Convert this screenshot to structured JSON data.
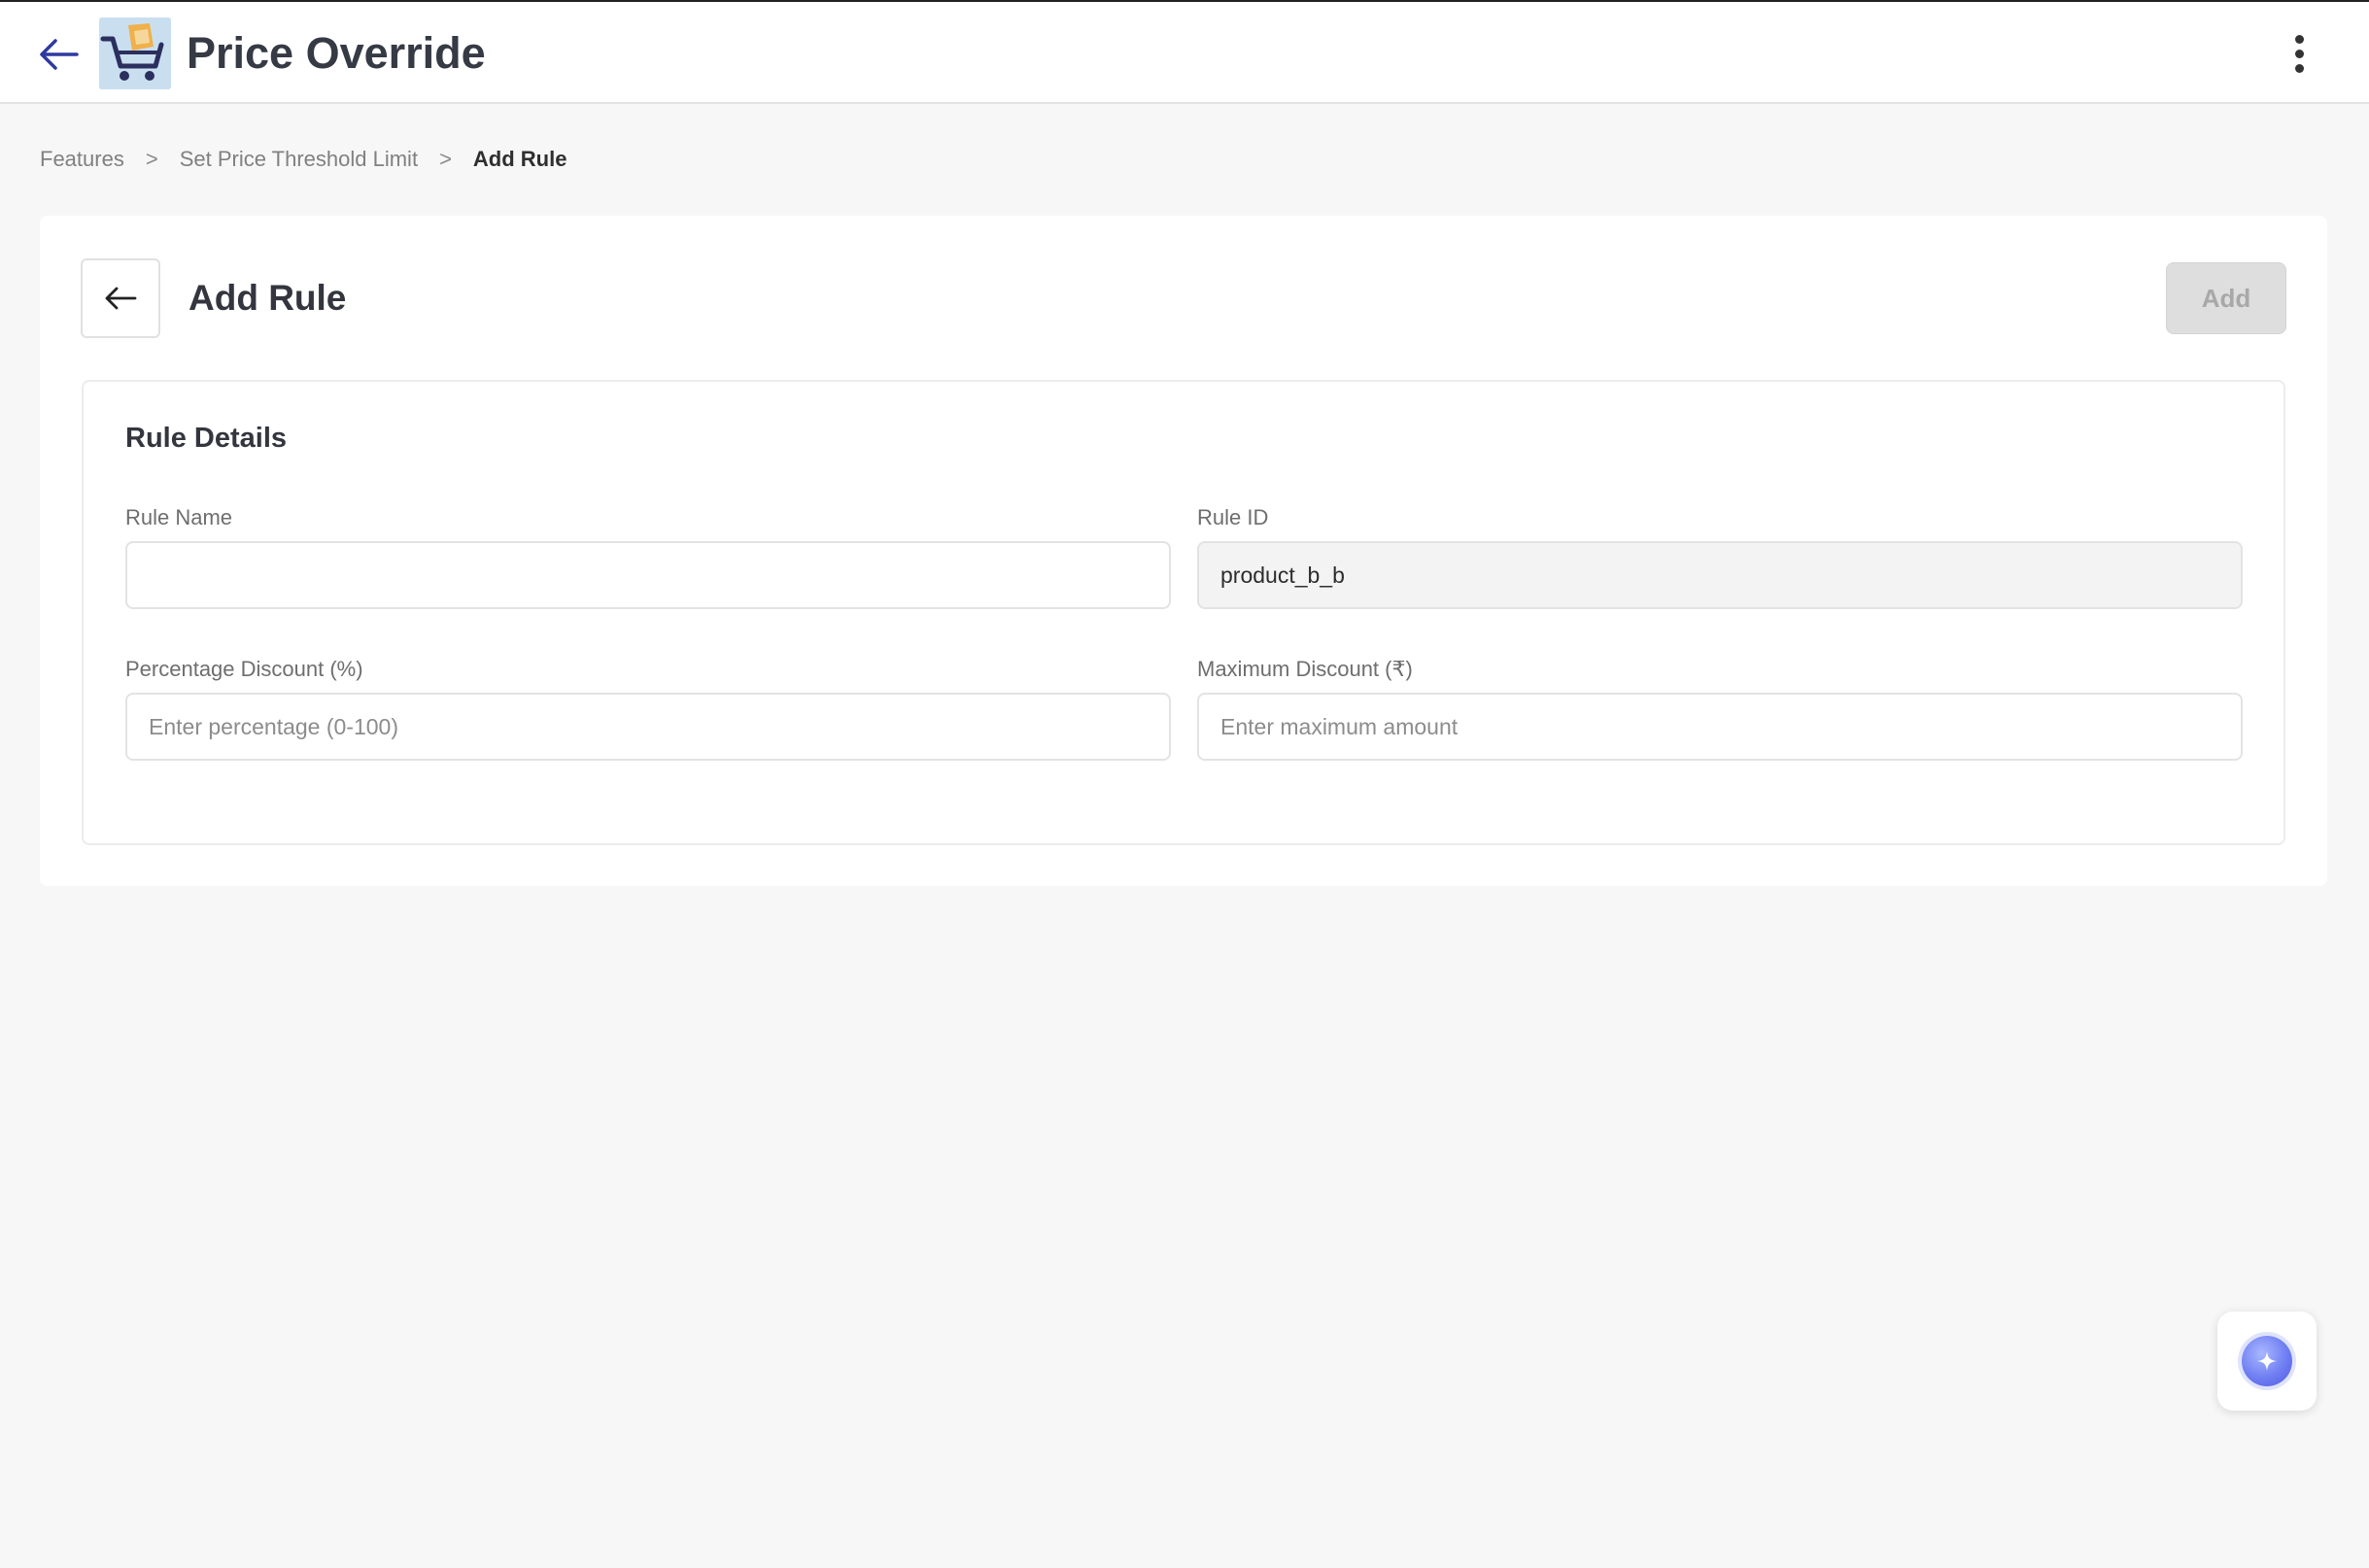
{
  "header": {
    "title": "Price Override",
    "back_icon": "arrow-left-icon",
    "logo_icon": "shopping-cart-logo-icon",
    "menu_icon": "kebab-menu-icon"
  },
  "breadcrumb": {
    "items": [
      "Features",
      "Set Price Threshold Limit",
      "Add Rule"
    ],
    "separator": ">"
  },
  "page": {
    "title": "Add Rule",
    "back_icon": "arrow-left-icon",
    "add_label": "Add",
    "add_disabled": true
  },
  "rule_details": {
    "title": "Rule Details",
    "rule_name": {
      "label": "Rule Name",
      "value": "",
      "placeholder": ""
    },
    "rule_id": {
      "label": "Rule ID",
      "value": "product_b_b",
      "readonly": true
    },
    "percentage_discount": {
      "label": "Percentage Discount (%)",
      "value": "",
      "placeholder": "Enter percentage (0-100)"
    },
    "maximum_discount": {
      "label": "Maximum Discount (₹)",
      "value": "",
      "placeholder": "Enter maximum amount"
    }
  },
  "assistant": {
    "icon": "sparkle-assistant-icon"
  },
  "colors": {
    "accent": "#2e3a9e",
    "disabled_button": "#dedede",
    "background": "#f7f7f7"
  }
}
